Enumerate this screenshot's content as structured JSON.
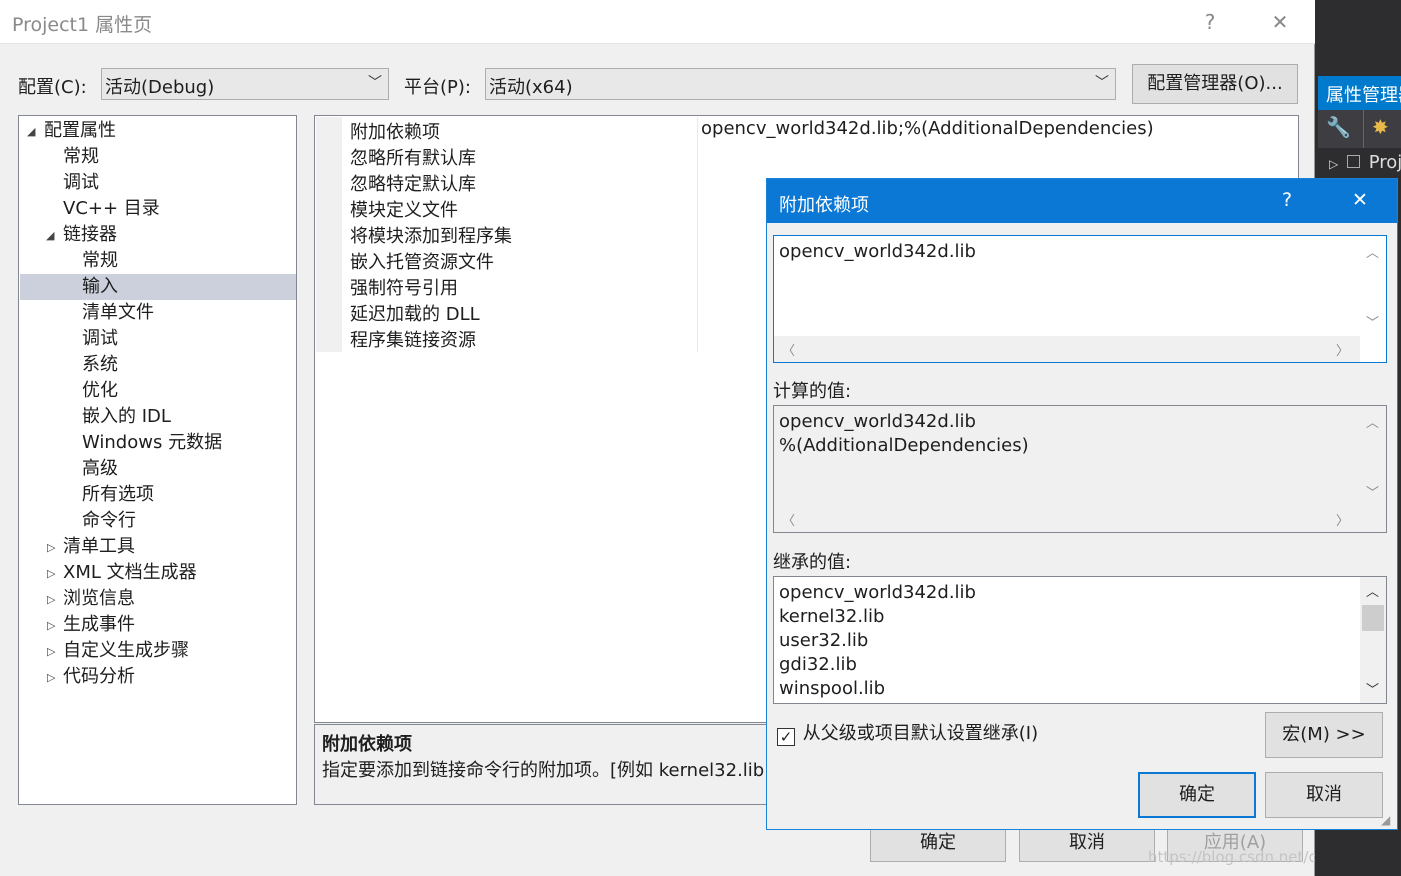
{
  "window": {
    "title": "Project1 属性页",
    "help": "?",
    "close": "✕"
  },
  "toolbar": {
    "config_label": "配置(C):",
    "config_value": "活动(Debug)",
    "platform_label": "平台(P):",
    "platform_value": "活动(x64)",
    "config_manager": "配置管理器(O)..."
  },
  "tree": {
    "root": "配置属性",
    "items": [
      "常规",
      "调试",
      "VC++ 目录"
    ],
    "linker": "链接器",
    "linker_items": [
      "常规",
      "输入",
      "清单文件",
      "调试",
      "系统",
      "优化",
      "嵌入的 IDL",
      "Windows 元数据",
      "高级",
      "所有选项",
      "命令行"
    ],
    "collapsed": [
      "清单工具",
      "XML 文档生成器",
      "浏览信息",
      "生成事件",
      "自定义生成步骤",
      "代码分析"
    ]
  },
  "grid": {
    "rows": [
      {
        "name": "附加依赖项",
        "value": "opencv_world342d.lib;%(AdditionalDependencies)"
      },
      {
        "name": "忽略所有默认库",
        "value": ""
      },
      {
        "name": "忽略特定默认库",
        "value": ""
      },
      {
        "name": "模块定义文件",
        "value": ""
      },
      {
        "name": "将模块添加到程序集",
        "value": ""
      },
      {
        "name": "嵌入托管资源文件",
        "value": ""
      },
      {
        "name": "强制符号引用",
        "value": ""
      },
      {
        "name": "延迟加载的 DLL",
        "value": ""
      },
      {
        "name": "程序集链接资源",
        "value": ""
      }
    ]
  },
  "description": {
    "title": "附加依赖项",
    "text": "指定要添加到链接命令行的附加项。[例如 kernel32.lib]"
  },
  "bottom_buttons": {
    "ok": "确定",
    "cancel": "取消",
    "apply": "应用(A)"
  },
  "watermark": "https://blog.csdn.net/qq_41202903",
  "vs_panel": {
    "header": "属性管理器",
    "project": "Proje"
  },
  "dialog": {
    "title": "附加依赖项",
    "help": "?",
    "close": "✕",
    "edit_value": "opencv_world342d.lib",
    "computed_label": "计算的值:",
    "computed_lines": [
      "opencv_world342d.lib",
      "%(AdditionalDependencies)"
    ],
    "inherited_label": "继承的值:",
    "inherited_lines": [
      "opencv_world342d.lib",
      "kernel32.lib",
      "user32.lib",
      "gdi32.lib",
      "winspool.lib"
    ],
    "inherit_checkbox": "从父级或项目默认设置继承(I)",
    "inherit_checked": true,
    "macro_button": "宏(M) >>",
    "ok": "确定",
    "cancel": "取消"
  }
}
